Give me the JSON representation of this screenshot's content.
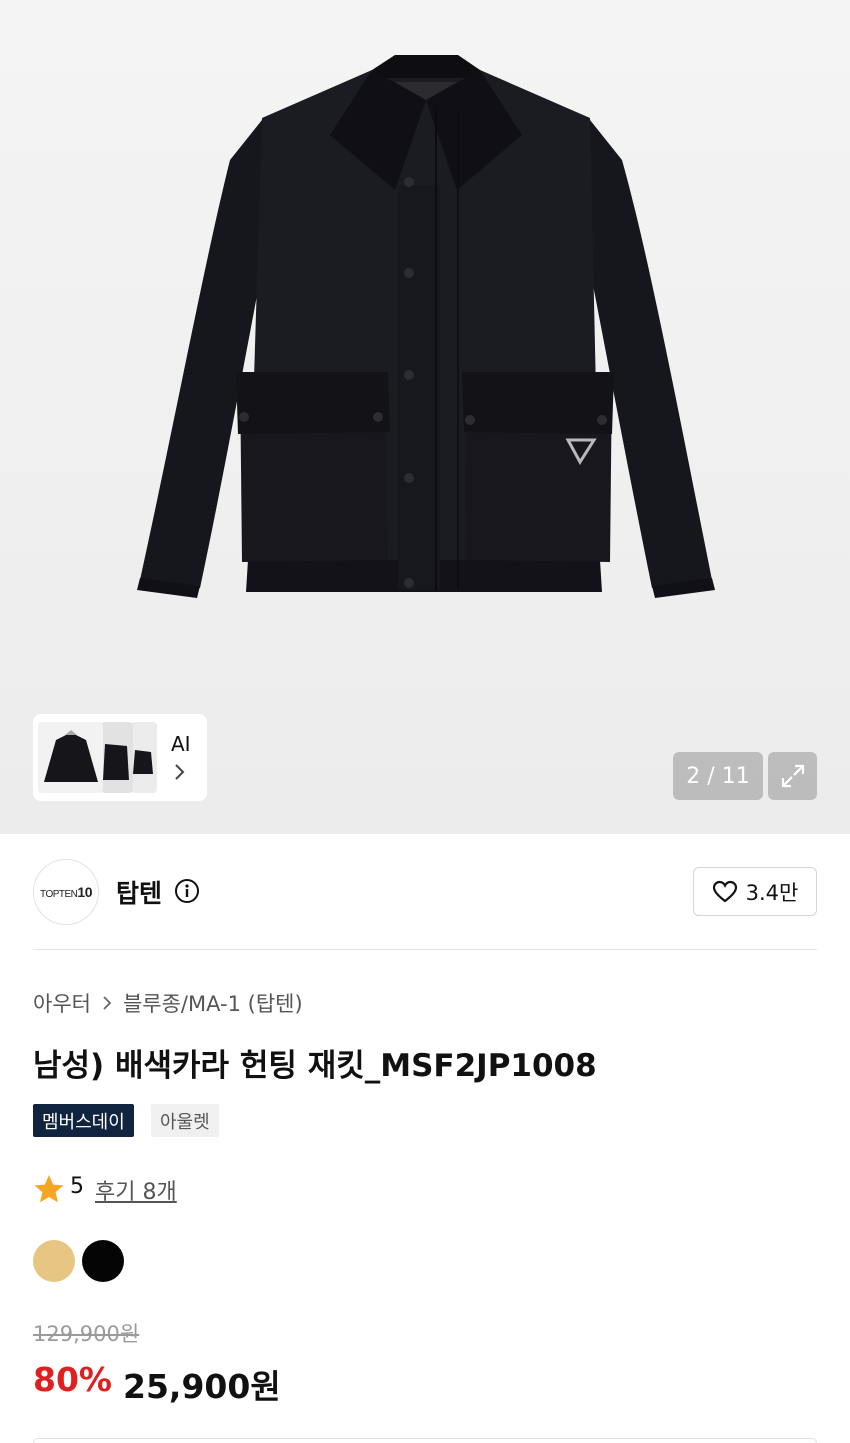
{
  "gallery": {
    "product_image": "black-collar-jacket",
    "ai_thumbnails": {
      "label": "AI",
      "arrow_icon": "chevron-right-icon"
    },
    "page_counter": "2 / 11",
    "expand_icon": "expand-icon"
  },
  "brand": {
    "logo_text_prefix": "TOPTEN",
    "logo_text_suffix": "10",
    "name": "탑텐",
    "info_icon": "info-icon",
    "like_icon": "heart-outline-icon",
    "like_count": "3.4만"
  },
  "product": {
    "breadcrumb": [
      "아우터",
      "블루종/MA-1 (탑텐)"
    ],
    "title": "남성) 배색카라 헌팅 재킷_MSF2JP1008",
    "badges": {
      "member": "멤버스데이",
      "outlet": "아울렛"
    },
    "rating": {
      "star_icon": "star-icon",
      "value": "5",
      "reviews": "후기 8개"
    },
    "colors": [
      "#e6c682",
      "#050505"
    ],
    "price": {
      "original": "129,900원",
      "discount": "80%",
      "sale": "25,900원"
    }
  },
  "theme": {
    "discount_color": "#e02020",
    "member_badge_color": "#10243f"
  }
}
